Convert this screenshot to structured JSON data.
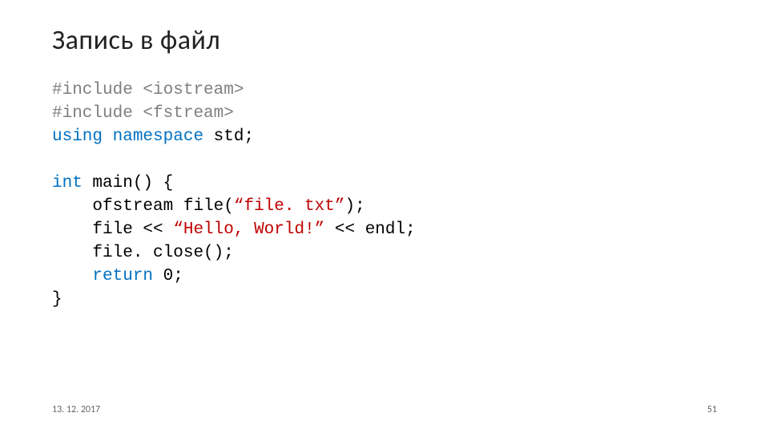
{
  "title": "Запись в файл",
  "code": {
    "l1": {
      "a": "#include",
      "b": " <iostream>"
    },
    "l2": {
      "a": "#include",
      "b": " <fstream>"
    },
    "l3": {
      "a": "using",
      "b": " ",
      "c": "namespace",
      "d": " std;"
    },
    "l4": {
      "a": "int",
      "b": " main() {"
    },
    "l5": {
      "indent": "    ",
      "a": "ofstream file(",
      "b": "“file. txt”",
      "c": ");"
    },
    "l6": {
      "indent": "    ",
      "a": "file << ",
      "b": "“Hello, World!”",
      "c": " << endl;"
    },
    "l7": {
      "indent": "    ",
      "a": "file. close();"
    },
    "l8": {
      "indent": "    ",
      "a": "return",
      "b": " 0;"
    },
    "l9": {
      "a": "}"
    }
  },
  "footer": {
    "date": "13. 12. 2017",
    "page": "51"
  }
}
